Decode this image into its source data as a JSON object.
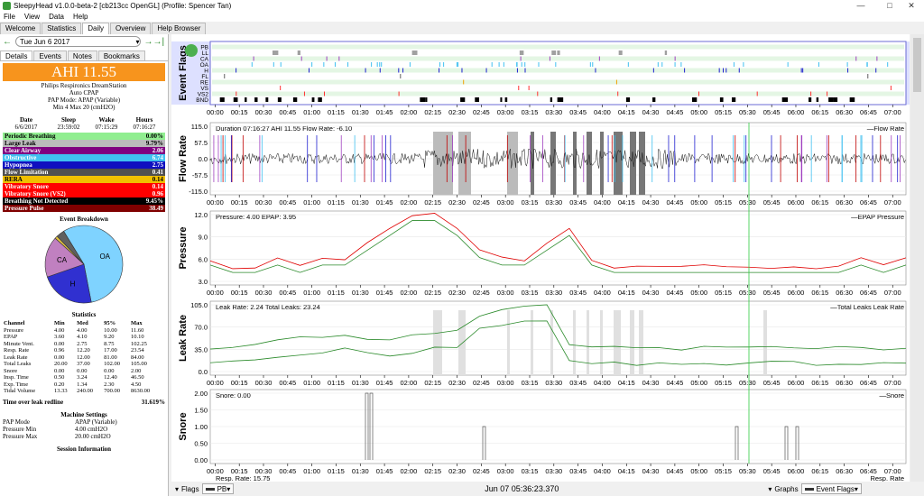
{
  "window": {
    "title": "SleepyHead v1.0.0-beta-2 [cb213cc OpenGL] (Profile: Spencer Tan)",
    "min": "—",
    "max": "□",
    "close": "✕"
  },
  "menu": [
    "File",
    "View",
    "Data",
    "Help"
  ],
  "tabs": [
    "Welcome",
    "Statistics",
    "Daily",
    "Overview",
    "Help Browser"
  ],
  "active_tab": "Daily",
  "date": {
    "label": "Tue Jun 6 2017",
    "prev": "←",
    "next": "→",
    "today": "→|"
  },
  "subtabs": [
    "Details",
    "Events",
    "Notes",
    "Bookmarks"
  ],
  "ahi": "AHI 11.55",
  "machine": {
    "line1": "Philips Respironics DreamStation",
    "line2": "Auto CPAP",
    "line3": "PAP Mode: APAP (Variable)",
    "line4": "Min 4 Max 20 (cmH2O)"
  },
  "session_header": [
    "Date",
    "Sleep",
    "Wake",
    "Hours"
  ],
  "session_row": [
    "6/6/2017",
    "23:59:02",
    "07:15:29",
    "07:16:27"
  ],
  "events": [
    {
      "label": "Periodic Breathing",
      "value": "0.00%",
      "bg": "#90ee90",
      "fg": "#000"
    },
    {
      "label": "Large Leak",
      "value": "9.79%",
      "bg": "#bbbbbb",
      "fg": "#000"
    },
    {
      "label": "Clear Airway",
      "value": "2.06",
      "bg": "#800080",
      "fg": "#fff"
    },
    {
      "label": "Obstructive",
      "value": "6.74",
      "bg": "#40c0f0",
      "fg": "#fff"
    },
    {
      "label": "Hypopnea",
      "value": "2.75",
      "bg": "#1010c0",
      "fg": "#fff"
    },
    {
      "label": "Flow Limitation",
      "value": "0.41",
      "bg": "#505050",
      "fg": "#fff"
    },
    {
      "label": "RERA",
      "value": "0.14",
      "bg": "#f0c000",
      "fg": "#000"
    },
    {
      "label": "Vibratory Snore",
      "value": "0.14",
      "bg": "#ff0000",
      "fg": "#fff"
    },
    {
      "label": "Vibratory Snore (VS2)",
      "value": "0.96",
      "bg": "#ff0000",
      "fg": "#fff"
    },
    {
      "label": "Breathing Not Detected",
      "value": "9.45%",
      "bg": "#000000",
      "fg": "#fff"
    },
    {
      "label": "Pressure Pulse",
      "value": "38.49",
      "bg": "#800000",
      "fg": "#fff"
    }
  ],
  "event_breakdown": {
    "title": "Event Breakdown",
    "slices": [
      {
        "label": "OA",
        "value": 6.74,
        "color": "#7fd3ff"
      },
      {
        "label": "H",
        "value": 2.75,
        "color": "#3030d0"
      },
      {
        "label": "CA",
        "value": 2.06,
        "color": "#c080c0"
      },
      {
        "label": "",
        "value": 0.14,
        "color": "#e0c040"
      },
      {
        "label": "",
        "value": 0.41,
        "color": "#606060"
      }
    ]
  },
  "statistics": {
    "title": "Statistics",
    "headers": [
      "Channel",
      "Min",
      "Med",
      "95%",
      "Max"
    ],
    "rows": [
      [
        "Pressure",
        "4.00",
        "4.00",
        "10.00",
        "11.60"
      ],
      [
        "EPAP",
        "3.60",
        "4.10",
        "9.20",
        "10.10"
      ],
      [
        "Minute Vent.",
        "0.00",
        "2.75",
        "8.75",
        "102.25"
      ],
      [
        "Resp. Rate",
        "0.96",
        "12.20",
        "17.00",
        "23.54"
      ],
      [
        "Leak Rate",
        "0.00",
        "12.00",
        "81.00",
        "84.00"
      ],
      [
        "Total Leaks",
        "20.00",
        "37.00",
        "102.00",
        "105.00"
      ],
      [
        "Snore",
        "0.00",
        "0.00",
        "0.00",
        "2.00"
      ],
      [
        "Insp. Time",
        "0.50",
        "3.24",
        "12.40",
        "46.50"
      ],
      [
        "Exp. Time",
        "0.20",
        "1.34",
        "2.30",
        "4.50"
      ],
      [
        "Tidal Volume",
        "13.33",
        "240.00",
        "700.00",
        "8630.00"
      ]
    ]
  },
  "time_over_leak": {
    "label": "Time over leak redline",
    "value": "31.619%"
  },
  "machine_settings": {
    "title": "Machine Settings",
    "rows": [
      [
        "PAP Mode",
        "APAP (Variable)"
      ],
      [
        "Pressure Min",
        "4.00 cmH2O"
      ],
      [
        "Pressure Max",
        "20.00 cmH2O"
      ]
    ]
  },
  "session_info": "Session Information",
  "time_ticks": [
    "00:00",
    "00:15",
    "00:30",
    "00:45",
    "01:00",
    "01:15",
    "01:30",
    "01:45",
    "02:00",
    "02:15",
    "02:30",
    "02:45",
    "03:00",
    "03:15",
    "03:30",
    "03:45",
    "04:00",
    "04:15",
    "04:30",
    "04:45",
    "05:00",
    "05:15",
    "05:30",
    "05:45",
    "06:00",
    "06:15",
    "06:30",
    "06:45",
    "07:00"
  ],
  "event_flags": {
    "ylabel": "Event Flags",
    "rows": [
      "PB",
      "LL",
      "CA",
      "OA",
      "H",
      "FL",
      "RE",
      "VS",
      "VS2",
      "BND"
    ]
  },
  "flow_rate": {
    "ylabel": "Flow Rate",
    "info": "Duration 07:16:27 AHI 11.55 Flow Rate: -6.10",
    "legend": "Flow Rate",
    "ticks": [
      "115.0",
      "57.5",
      "0.0",
      "-57.5",
      "-115.0"
    ]
  },
  "pressure": {
    "ylabel": "Pressure",
    "info": "Pressure: 4.00 EPAP: 3.95",
    "legend": "EPAP  Pressure",
    "ticks": [
      "12.0",
      "9.0",
      "6.0",
      "3.0"
    ]
  },
  "leak_rate": {
    "ylabel": "Leak Rate",
    "info": "Leak Rate: 2.24 Total Leaks: 23.24",
    "legend": "Total Leaks  Leak Rate",
    "ticks": [
      "105.0",
      "70.0",
      "35.0",
      "0.0"
    ]
  },
  "snore": {
    "ylabel": "Snore",
    "info": "Snore: 0.00",
    "legend": "Snore",
    "ticks": [
      "2.00",
      "1.50",
      "1.00",
      "0.50",
      "0.00"
    ]
  },
  "resp_rate": {
    "info": "Resp. Rate: 15.75",
    "legend": "Resp. Rate"
  },
  "bottom": {
    "flags": "Flags",
    "pb": "PB",
    "datetime": "Jun 07 05:36:23.370",
    "graphs": "Graphs",
    "event_flags": "Event Flags"
  },
  "colors": {
    "green": "#2a8a2a",
    "red": "#ff0000",
    "ahi_bg": "#f7941d"
  }
}
